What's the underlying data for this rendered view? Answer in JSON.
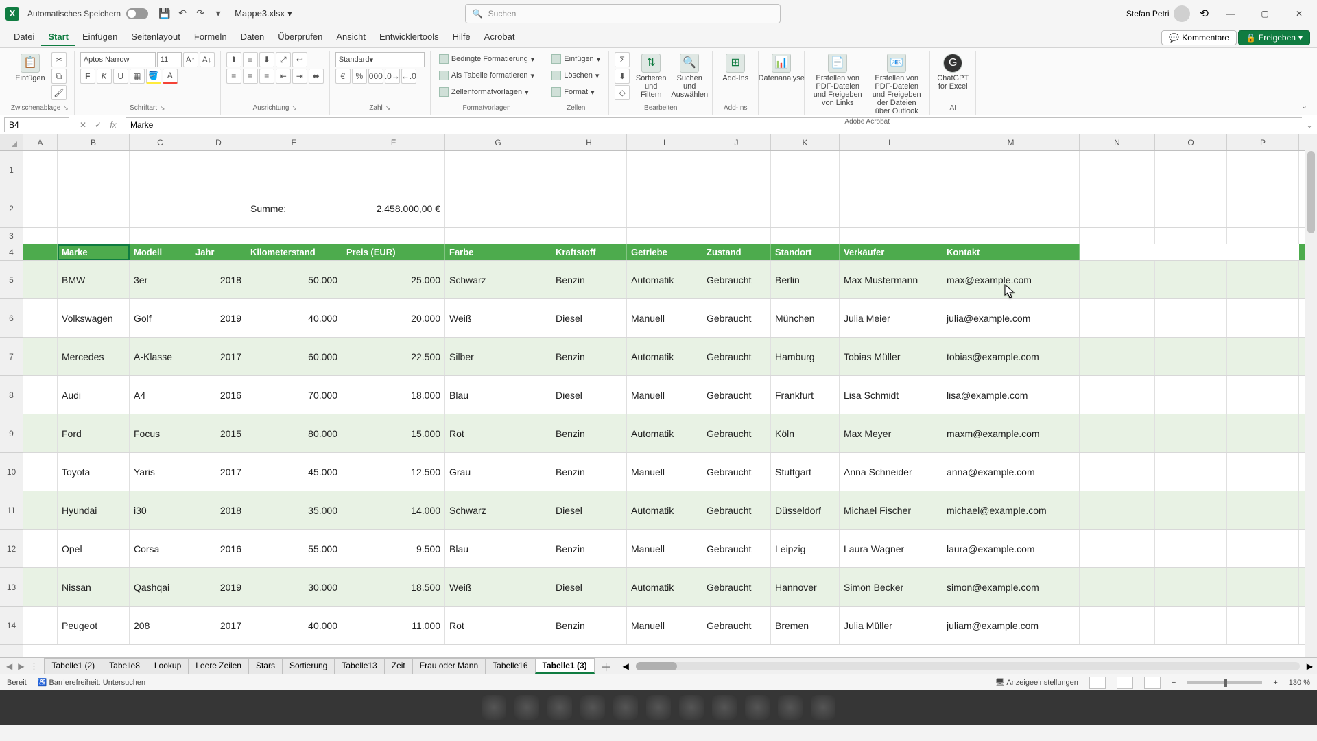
{
  "title": {
    "autosave_label": "Automatisches Speichern",
    "filename": "Mappe3.xlsx",
    "search_placeholder": "Suchen",
    "username": "Stefan Petri"
  },
  "ribbon_tabs": [
    "Datei",
    "Start",
    "Einfügen",
    "Seitenlayout",
    "Formeln",
    "Daten",
    "Überprüfen",
    "Ansicht",
    "Entwicklertools",
    "Hilfe",
    "Acrobat"
  ],
  "ribbon_active_tab": "Start",
  "ribbon_right": {
    "comments": "Kommentare",
    "share": "Freigeben"
  },
  "ribbon_groups": {
    "clipboard": {
      "paste": "Einfügen",
      "label": "Zwischenablage"
    },
    "font": {
      "name": "Aptos Narrow",
      "size": "11",
      "bold": "F",
      "italic": "K",
      "underline": "U",
      "label": "Schriftart"
    },
    "alignment": {
      "label": "Ausrichtung"
    },
    "number": {
      "format": "Standard",
      "label": "Zahl"
    },
    "styles": {
      "cond": "Bedingte Formatierung",
      "astable": "Als Tabelle formatieren",
      "cellstyles": "Zellenformatvorlagen",
      "label": "Formatvorlagen"
    },
    "cells": {
      "insert": "Einfügen",
      "delete": "Löschen",
      "format": "Format",
      "label": "Zellen"
    },
    "editing": {
      "sort": "Sortieren und Filtern",
      "find": "Suchen und Auswählen",
      "label": "Bearbeiten"
    },
    "addins": {
      "addins": "Add-Ins",
      "label": "Add-Ins"
    },
    "analyze": {
      "btn": "Datenanalyse"
    },
    "acrobat": {
      "btn1": "Erstellen von PDF-Dateien und Freigeben von Links",
      "btn2": "Erstellen von PDF-Dateien und Freigeben der Dateien über Outlook",
      "label": "Adobe Acrobat"
    },
    "ai": {
      "btn": "ChatGPT for Excel",
      "label": "AI"
    }
  },
  "namebox": "B4",
  "formula": "Marke",
  "columns": {
    "A": 50,
    "B": 105,
    "C": 90,
    "D": 80,
    "E": 140,
    "F": 150,
    "G": 155,
    "H": 110,
    "I": 110,
    "J": 100,
    "K": 100,
    "L": 150,
    "M": 200,
    "N": 110,
    "O": 105,
    "P": 105
  },
  "col_letters": [
    "A",
    "B",
    "C",
    "D",
    "E",
    "F",
    "G",
    "H",
    "I",
    "J",
    "K",
    "L",
    "M",
    "N",
    "O",
    "P"
  ],
  "row1_label": "1",
  "row2_label": "2",
  "row3_label": "3",
  "row4_label": "4",
  "sum_label": "Summe:",
  "sum_value": "2.458.000,00 €",
  "table_headers": [
    "Marke",
    "Modell",
    "Jahr",
    "Kilometerstand",
    "Preis (EUR)",
    "Farbe",
    "Kraftstoff",
    "Getriebe",
    "Zustand",
    "Standort",
    "Verkäufer",
    "Kontakt"
  ],
  "table_rows": [
    {
      "marke": "BMW",
      "modell": "3er",
      "jahr": "2018",
      "km": "50.000",
      "preis": "25.000",
      "farbe": "Schwarz",
      "kraft": "Benzin",
      "getriebe": "Automatik",
      "zustand": "Gebraucht",
      "standort": "Berlin",
      "verkaufer": "Max Mustermann",
      "kontakt": "max@example.com"
    },
    {
      "marke": "Volkswagen",
      "modell": "Golf",
      "jahr": "2019",
      "km": "40.000",
      "preis": "20.000",
      "farbe": "Weiß",
      "kraft": "Diesel",
      "getriebe": "Manuell",
      "zustand": "Gebraucht",
      "standort": "München",
      "verkaufer": "Julia Meier",
      "kontakt": "julia@example.com"
    },
    {
      "marke": "Mercedes",
      "modell": "A-Klasse",
      "jahr": "2017",
      "km": "60.000",
      "preis": "22.500",
      "farbe": "Silber",
      "kraft": "Benzin",
      "getriebe": "Automatik",
      "zustand": "Gebraucht",
      "standort": "Hamburg",
      "verkaufer": "Tobias Müller",
      "kontakt": "tobias@example.com"
    },
    {
      "marke": "Audi",
      "modell": "A4",
      "jahr": "2016",
      "km": "70.000",
      "preis": "18.000",
      "farbe": "Blau",
      "kraft": "Diesel",
      "getriebe": "Manuell",
      "zustand": "Gebraucht",
      "standort": "Frankfurt",
      "verkaufer": "Lisa Schmidt",
      "kontakt": "lisa@example.com"
    },
    {
      "marke": "Ford",
      "modell": "Focus",
      "jahr": "2015",
      "km": "80.000",
      "preis": "15.000",
      "farbe": "Rot",
      "kraft": "Benzin",
      "getriebe": "Automatik",
      "zustand": "Gebraucht",
      "standort": "Köln",
      "verkaufer": "Max Meyer",
      "kontakt": "maxm@example.com"
    },
    {
      "marke": "Toyota",
      "modell": "Yaris",
      "jahr": "2017",
      "km": "45.000",
      "preis": "12.500",
      "farbe": "Grau",
      "kraft": "Benzin",
      "getriebe": "Manuell",
      "zustand": "Gebraucht",
      "standort": "Stuttgart",
      "verkaufer": "Anna Schneider",
      "kontakt": "anna@example.com"
    },
    {
      "marke": "Hyundai",
      "modell": "i30",
      "jahr": "2018",
      "km": "35.000",
      "preis": "14.000",
      "farbe": "Schwarz",
      "kraft": "Diesel",
      "getriebe": "Automatik",
      "zustand": "Gebraucht",
      "standort": "Düsseldorf",
      "verkaufer": "Michael Fischer",
      "kontakt": "michael@example.com"
    },
    {
      "marke": "Opel",
      "modell": "Corsa",
      "jahr": "2016",
      "km": "55.000",
      "preis": "9.500",
      "farbe": "Blau",
      "kraft": "Benzin",
      "getriebe": "Manuell",
      "zustand": "Gebraucht",
      "standort": "Leipzig",
      "verkaufer": "Laura Wagner",
      "kontakt": "laura@example.com"
    },
    {
      "marke": "Nissan",
      "modell": "Qashqai",
      "jahr": "2019",
      "km": "30.000",
      "preis": "18.500",
      "farbe": "Weiß",
      "kraft": "Diesel",
      "getriebe": "Automatik",
      "zustand": "Gebraucht",
      "standort": "Hannover",
      "verkaufer": "Simon Becker",
      "kontakt": "simon@example.com"
    },
    {
      "marke": "Peugeot",
      "modell": "208",
      "jahr": "2017",
      "km": "40.000",
      "preis": "11.000",
      "farbe": "Rot",
      "kraft": "Benzin",
      "getriebe": "Manuell",
      "zustand": "Gebraucht",
      "standort": "Bremen",
      "verkaufer": "Julia Müller",
      "kontakt": "juliam@example.com"
    }
  ],
  "row_numbers": [
    "5",
    "6",
    "7",
    "8",
    "9",
    "10",
    "11",
    "12",
    "13",
    "14"
  ],
  "sheets": [
    "Tabelle1 (2)",
    "Tabelle8",
    "Lookup",
    "Leere Zeilen",
    "Stars",
    "Sortierung",
    "Tabelle13",
    "Zeit",
    "Frau oder Mann",
    "Tabelle16",
    "Tabelle1 (3)"
  ],
  "active_sheet": "Tabelle1 (3)",
  "status": {
    "ready": "Bereit",
    "access": "Barrierefreiheit: Untersuchen",
    "display": "Anzeigeeinstellungen",
    "zoom": "130 %"
  }
}
